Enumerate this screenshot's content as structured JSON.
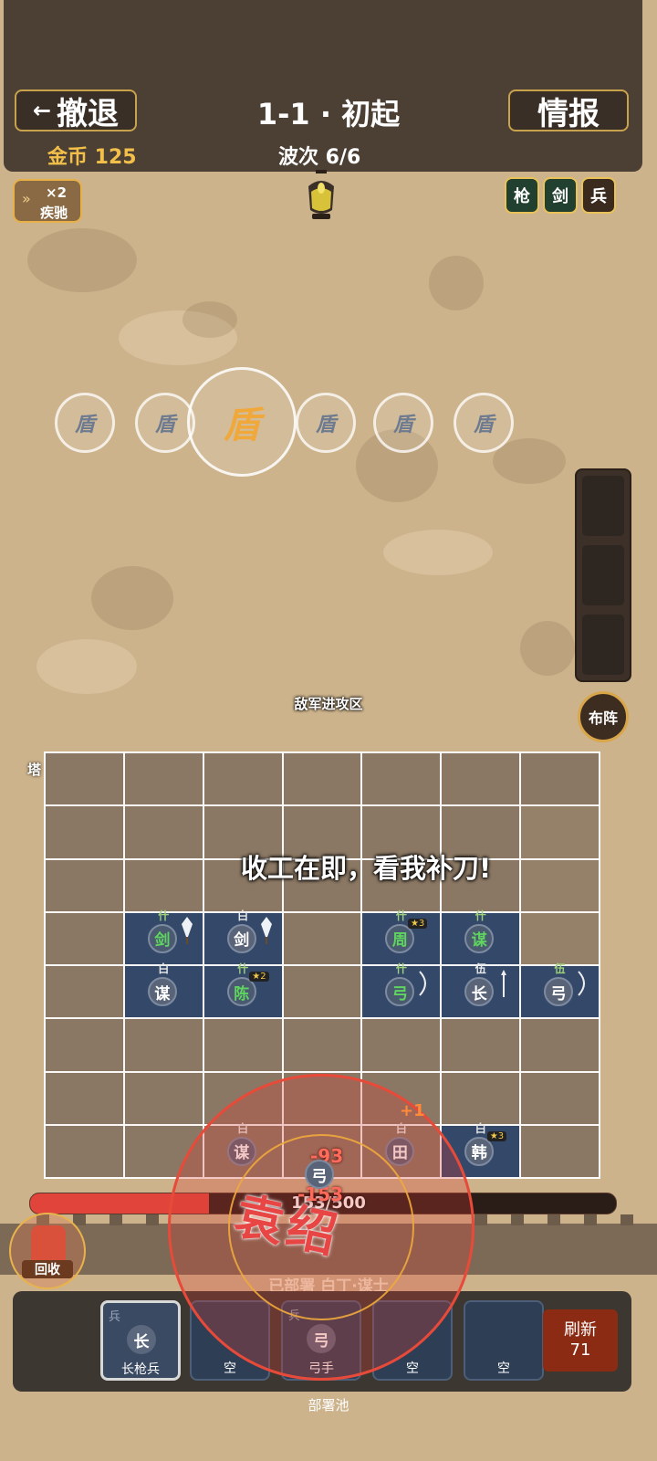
{
  "header": {
    "retreat_label": "撤退",
    "intel_label": "情报",
    "level_title": "1-1 · 初起",
    "gold": "金币 125",
    "wave": "波次 6/6"
  },
  "speed": {
    "multiplier": "×2",
    "label": "疾驰"
  },
  "unit_types": [
    "枪",
    "剑",
    "兵"
  ],
  "enemies": [
    "盾",
    "盾",
    "盾",
    "盾",
    "盾",
    "盾"
  ],
  "side": {
    "deploy_label": "布阵"
  },
  "board": {
    "zone_label": "敌军进攻区",
    "tower_label": "塔",
    "battle_cry": "收工在即，看我补刀!",
    "units": [
      {
        "rank": "什",
        "name": "剑",
        "green": true
      },
      {
        "rank": "白",
        "name": "剑",
        "green": false
      },
      {
        "rank": "什",
        "name": "周",
        "green": true,
        "star": "★3"
      },
      {
        "rank": "什",
        "name": "谋",
        "green": true
      },
      {
        "rank": "白",
        "name": "谋",
        "green": false
      },
      {
        "rank": "什",
        "name": "陈",
        "green": true,
        "star": "★2"
      },
      {
        "rank": "什",
        "name": "弓",
        "green": true
      },
      {
        "rank": "伍",
        "name": "长",
        "green": false
      },
      {
        "rank": "伍",
        "name": "弓",
        "green": false
      },
      {
        "rank": "白",
        "name": "谋",
        "green": false
      },
      {
        "rank": "白",
        "name": "田",
        "green": false
      },
      {
        "rank": "白",
        "name": "韩",
        "green": false,
        "star": "★3"
      }
    ]
  },
  "boss": {
    "name": "袁绍",
    "damage_1": "-93",
    "damage_2": "-153",
    "gain": "+1",
    "arrow_unit": "弓"
  },
  "hp": {
    "current": 153,
    "max": 500,
    "text": "/500"
  },
  "deployed_text": "已部署 白丁·谋士",
  "recycle_label": "回收",
  "pool": {
    "label": "部署池",
    "cards": [
      {
        "type": "兵",
        "icon": "长",
        "name": "长枪兵"
      },
      {
        "type": "",
        "icon": "",
        "name": "空"
      },
      {
        "type": "兵",
        "icon": "弓",
        "name": "弓手"
      },
      {
        "type": "",
        "icon": "",
        "name": "空"
      },
      {
        "type": "",
        "icon": "",
        "name": "空"
      }
    ],
    "refresh_label": "刷新",
    "refresh_cost": "71"
  },
  "colors": {
    "hp_fill": "#e1443b",
    "accent_gold": "#e9c25a",
    "unit_cell": "#34496a"
  }
}
